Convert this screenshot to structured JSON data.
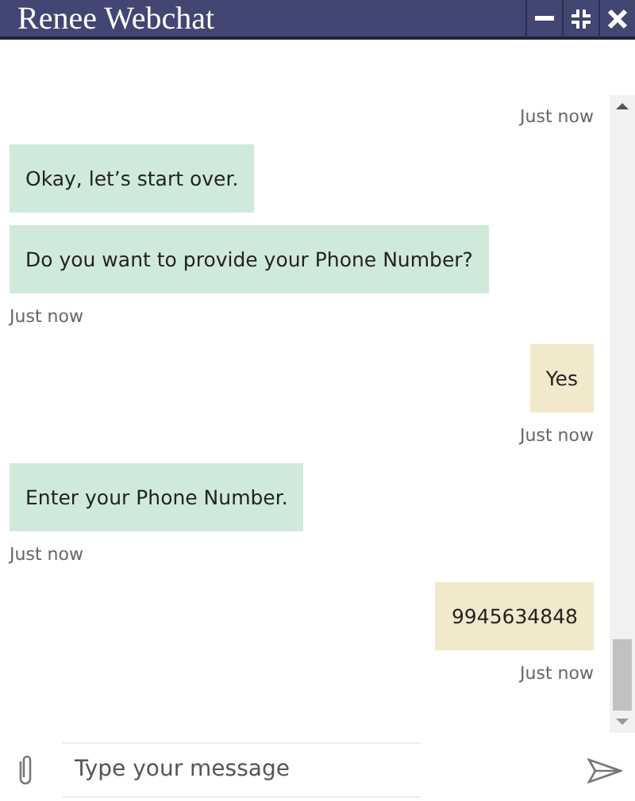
{
  "window": {
    "title": "Renee Webchat"
  },
  "messages": [
    {
      "kind": "sent_time",
      "text": "Just now"
    },
    {
      "kind": "received",
      "text": "Okay, let’s start over."
    },
    {
      "kind": "received",
      "text": "Do you want to provide your Phone Number?"
    },
    {
      "kind": "received_time",
      "text": "Just now"
    },
    {
      "kind": "sent",
      "text": "Yes"
    },
    {
      "kind": "sent_time",
      "text": "Just now"
    },
    {
      "kind": "received",
      "text": "Enter your Phone Number."
    },
    {
      "kind": "received_time",
      "text": "Just now"
    },
    {
      "kind": "sent",
      "text": "9945634848"
    },
    {
      "kind": "sent_time",
      "text": "Just now"
    }
  ],
  "composer": {
    "placeholder": "Type your message"
  }
}
